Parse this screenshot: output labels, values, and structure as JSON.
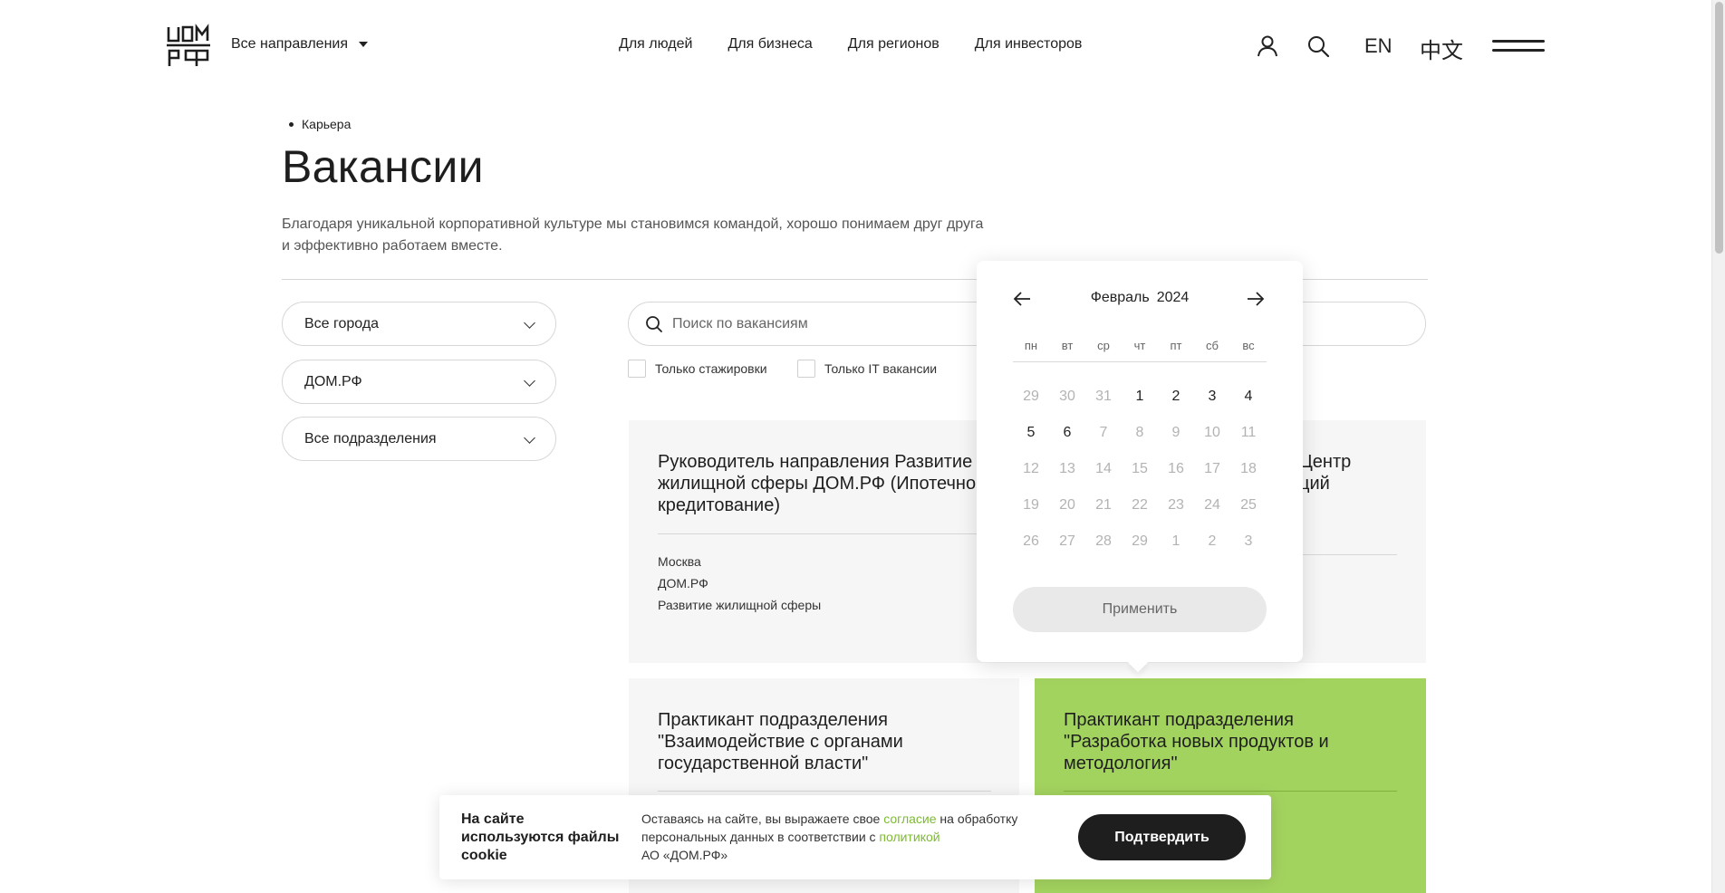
{
  "header": {
    "logo_text": "ДОМ.РФ",
    "directions_label": "Все направления",
    "nav": [
      "Для людей",
      "Для бизнеса",
      "Для регионов",
      "Для инвесторов"
    ],
    "lang_en": "EN",
    "lang_cn": "中文",
    "icons": [
      "user-icon",
      "search-icon",
      "menu-icon"
    ]
  },
  "breadcrumb": "Карьера",
  "page": {
    "title": "Вакансии",
    "intro_line1": "Благодаря уникальной корпоративной культуре мы становимся командой, хорошо понимаем друг друга",
    "intro_line2": "и эффективно работаем вместе."
  },
  "filters": {
    "city": "Все города",
    "company": "ДОМ.РФ",
    "department": "Все подразделения"
  },
  "search": {
    "placeholder": "Поиск по вакансиям",
    "check_internships": "Только стажировки",
    "check_it": "Только IT вакансии"
  },
  "cards": [
    {
      "title": "Руководитель направления Развитие жилищной сферы ДОМ.РФ (Ипотечное кредитование)",
      "city": "Москва",
      "company": "ДОМ.РФ",
      "department": "Развитие жилищной сферы"
    },
    {
      "title_partial_1": "Центр",
      "title_partial_2": "ций"
    },
    {
      "title": "Практикант подразделения \"Взаимодействие с органами государственной власти\""
    },
    {
      "title": "Практикант подразделения \"Разработка новых продуктов и методология\""
    }
  ],
  "calendar": {
    "month": "Февраль",
    "year": "2024",
    "weekdays": [
      "пн",
      "вт",
      "ср",
      "чт",
      "пт",
      "сб",
      "вс"
    ],
    "weeks": [
      [
        "29",
        "30",
        "31",
        "1",
        "2",
        "3",
        "4"
      ],
      [
        "5",
        "6",
        "7",
        "8",
        "9",
        "10",
        "11"
      ],
      [
        "12",
        "13",
        "14",
        "15",
        "16",
        "17",
        "18"
      ],
      [
        "19",
        "20",
        "21",
        "22",
        "23",
        "24",
        "25"
      ],
      [
        "26",
        "27",
        "28",
        "29",
        "1",
        "2",
        "3"
      ]
    ],
    "enabled": [
      [
        false,
        false,
        false,
        true,
        true,
        true,
        true
      ],
      [
        true,
        true,
        false,
        false,
        false,
        false,
        false
      ],
      [
        false,
        false,
        false,
        false,
        false,
        false,
        false
      ],
      [
        false,
        false,
        false,
        false,
        false,
        false,
        false
      ],
      [
        false,
        false,
        false,
        false,
        false,
        false,
        false
      ]
    ],
    "apply_label": "Применить"
  },
  "cookie": {
    "title": "На сайте используются файлы cookie",
    "text_1": "Оставаясь на сайте, вы выражаете свое ",
    "link_consent": "согласие",
    "text_2": " на обработку персональных данных в соответствии с ",
    "link_policy": "политикой",
    "text_3": "АО «ДОМ.РФ»",
    "confirm_label": "Подтвердить"
  },
  "colors": {
    "accent_green": "#a3d35f",
    "link_green": "#7cbb30",
    "dark": "#1e1e1e"
  }
}
